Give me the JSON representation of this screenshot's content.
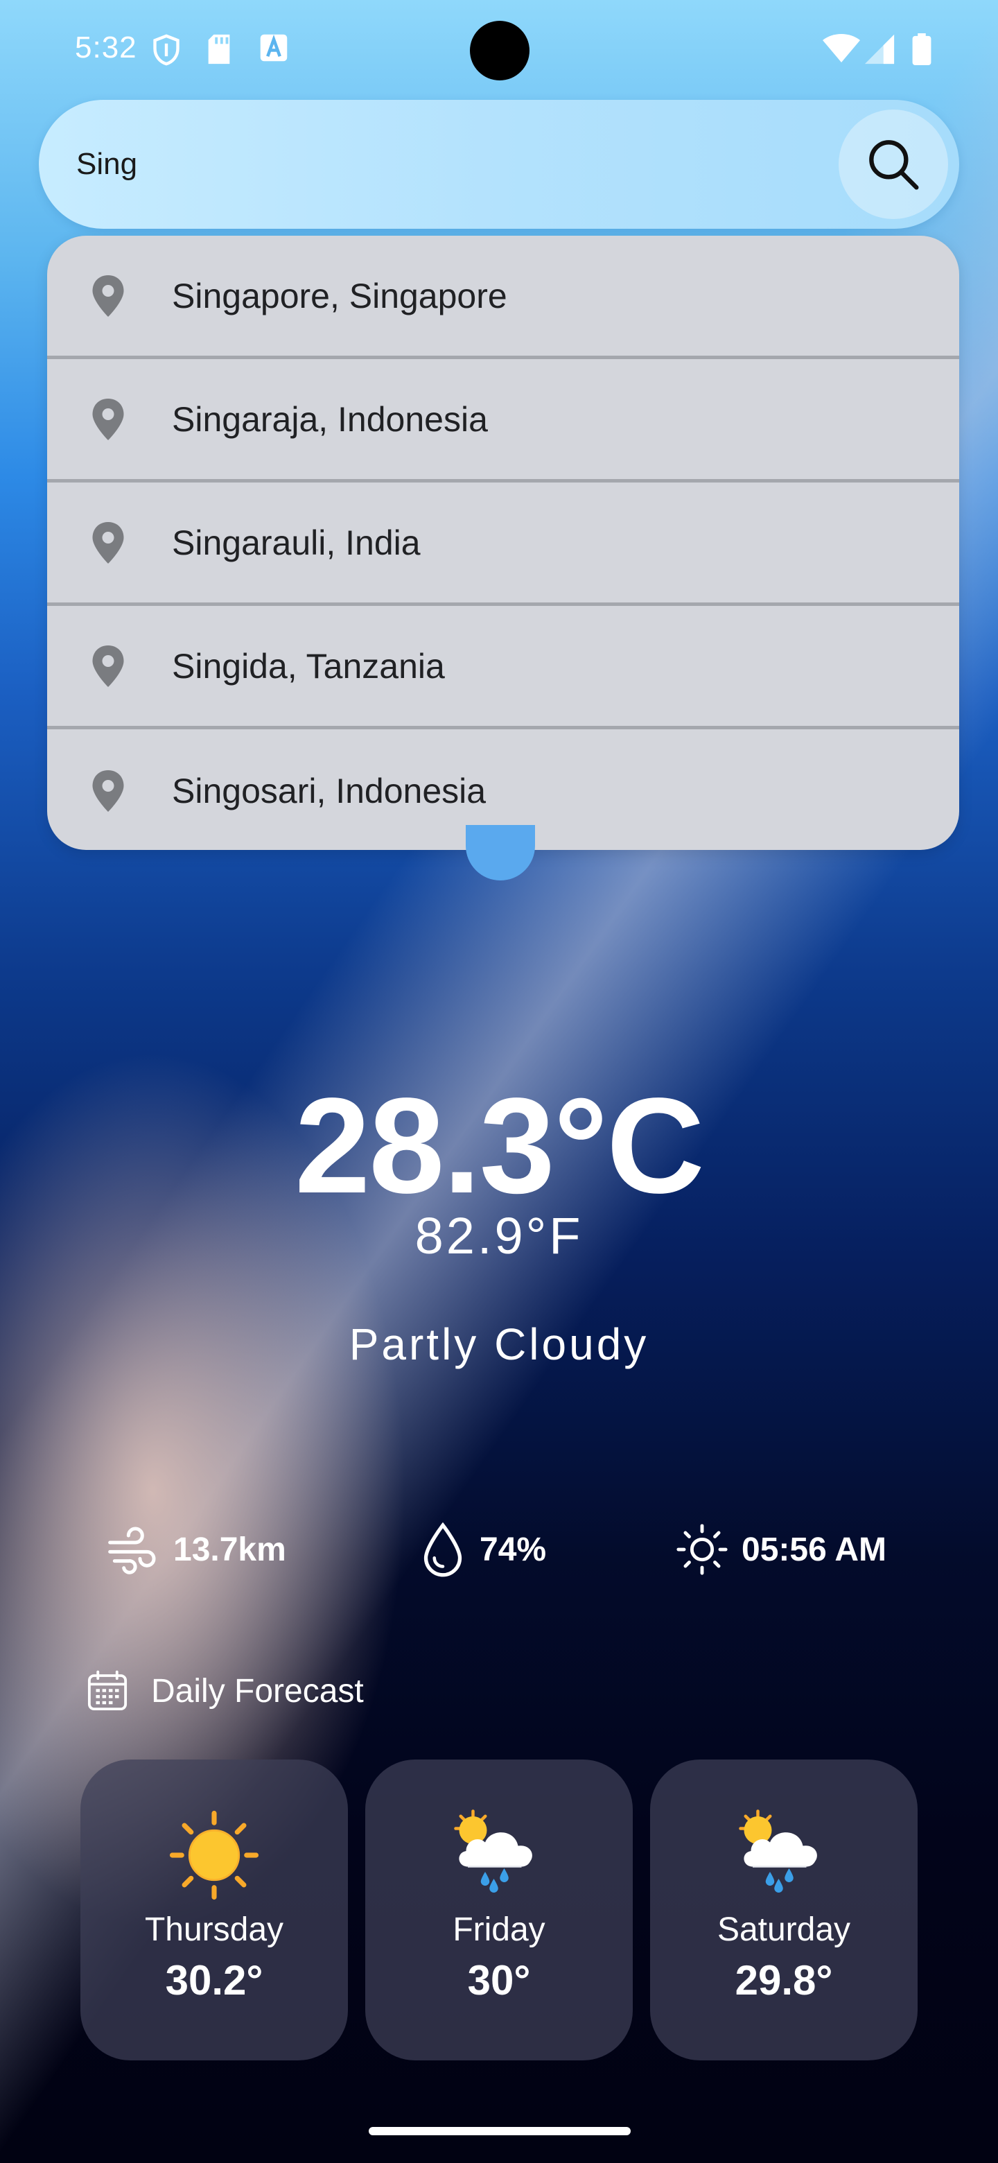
{
  "status_bar": {
    "time": "5:32",
    "icons": [
      "shield-icon",
      "sd-card-icon",
      "keyboard-a-icon",
      "wifi-icon",
      "signal-icon",
      "battery-icon"
    ]
  },
  "search": {
    "value": "Sing",
    "placeholder": "",
    "button_icon": "search-icon"
  },
  "suggestions": [
    {
      "label": "Singapore, Singapore",
      "icon": "location-pin-icon"
    },
    {
      "label": "Singaraja, Indonesia",
      "icon": "location-pin-icon"
    },
    {
      "label": "Singarauli, India",
      "icon": "location-pin-icon"
    },
    {
      "label": "Singida, Tanzania",
      "icon": "location-pin-icon"
    },
    {
      "label": "Singosari, Indonesia",
      "icon": "location-pin-icon"
    }
  ],
  "weather": {
    "temp_c": "28.3°C",
    "temp_f": "82.9°F",
    "condition": "Partly Cloudy"
  },
  "stats": {
    "wind": {
      "value": "13.7km",
      "icon": "wind-icon"
    },
    "humidity": {
      "value": "74%",
      "icon": "water-drop-icon"
    },
    "sunrise": {
      "value": "05:56 AM",
      "icon": "sun-icon"
    }
  },
  "forecast": {
    "title": "Daily Forecast",
    "icon": "calendar-icon",
    "days": [
      {
        "day": "Thursday",
        "temp": "30.2°",
        "icon": "sunny-icon"
      },
      {
        "day": "Friday",
        "temp": "30°",
        "icon": "sun-cloud-rain-icon"
      },
      {
        "day": "Saturday",
        "temp": "29.8°",
        "icon": "sun-cloud-rain-icon"
      }
    ]
  },
  "colors": {
    "suggestion_bg": "#d4d6dc",
    "search_bg": "#b3e2fd",
    "card_bg": "#3e4058",
    "sun_yellow": "#fcc62f",
    "rain_blue": "#3b9fe8"
  }
}
